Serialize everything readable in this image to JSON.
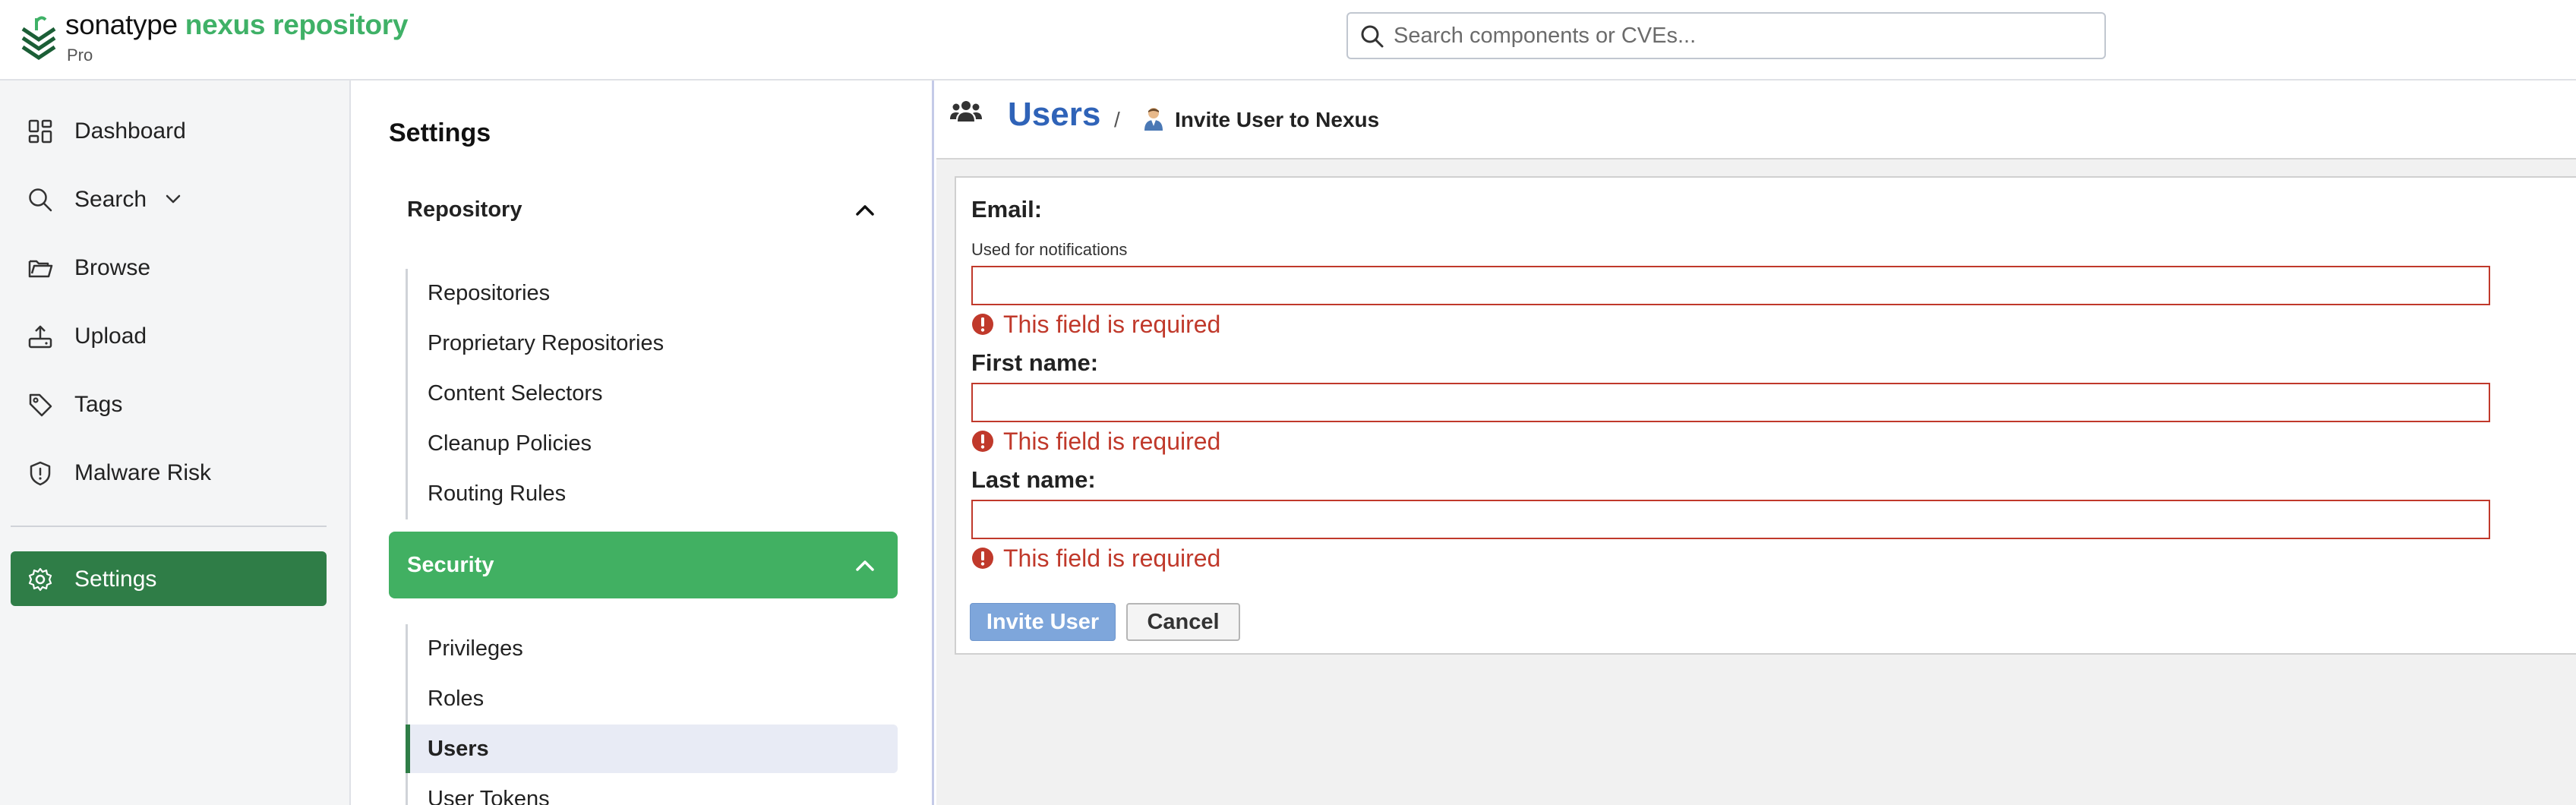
{
  "header": {
    "logo_brand": "sonatype",
    "logo_product": "nexus repository",
    "logo_edition": "Pro",
    "search_placeholder": "Search components or CVEs...",
    "search_value": ""
  },
  "leftnav": {
    "items": [
      {
        "label": "Dashboard",
        "icon": "dashboard-icon"
      },
      {
        "label": "Search",
        "icon": "search-icon"
      },
      {
        "label": "Browse",
        "icon": "folder-icon"
      },
      {
        "label": "Upload",
        "icon": "upload-icon"
      },
      {
        "label": "Tags",
        "icon": "tag-icon"
      },
      {
        "label": "Malware Risk",
        "icon": "shield-icon"
      },
      {
        "label": "Settings",
        "icon": "gear-icon",
        "active": true
      }
    ]
  },
  "settings": {
    "title": "Settings",
    "groups": [
      {
        "label": "Repository",
        "items": [
          "Repositories",
          "Proprietary Repositories",
          "Content Selectors",
          "Cleanup Policies",
          "Routing Rules"
        ]
      },
      {
        "label": "Security",
        "items": [
          "Privileges",
          "Roles",
          "Users",
          "User Tokens"
        ],
        "active_item": "Users"
      }
    ]
  },
  "breadcrumb": {
    "root": "Users",
    "separator": "/",
    "current": "Invite User to Nexus"
  },
  "form": {
    "email": {
      "label": "Email:",
      "help": "Used for notifications",
      "value": "",
      "error": "This field is required"
    },
    "first_name": {
      "label": "First name:",
      "value": "",
      "error": "This field is required"
    },
    "last_name": {
      "label": "Last name:",
      "value": "",
      "error": "This field is required"
    },
    "submit_label": "Invite User",
    "cancel_label": "Cancel"
  },
  "colors": {
    "brand_green": "#3fb167",
    "nav_active": "#2f7d47",
    "group_active": "#41b062",
    "link_blue": "#2f63b8",
    "error_red": "#c0392b",
    "button_primary": "#7ea6db"
  }
}
